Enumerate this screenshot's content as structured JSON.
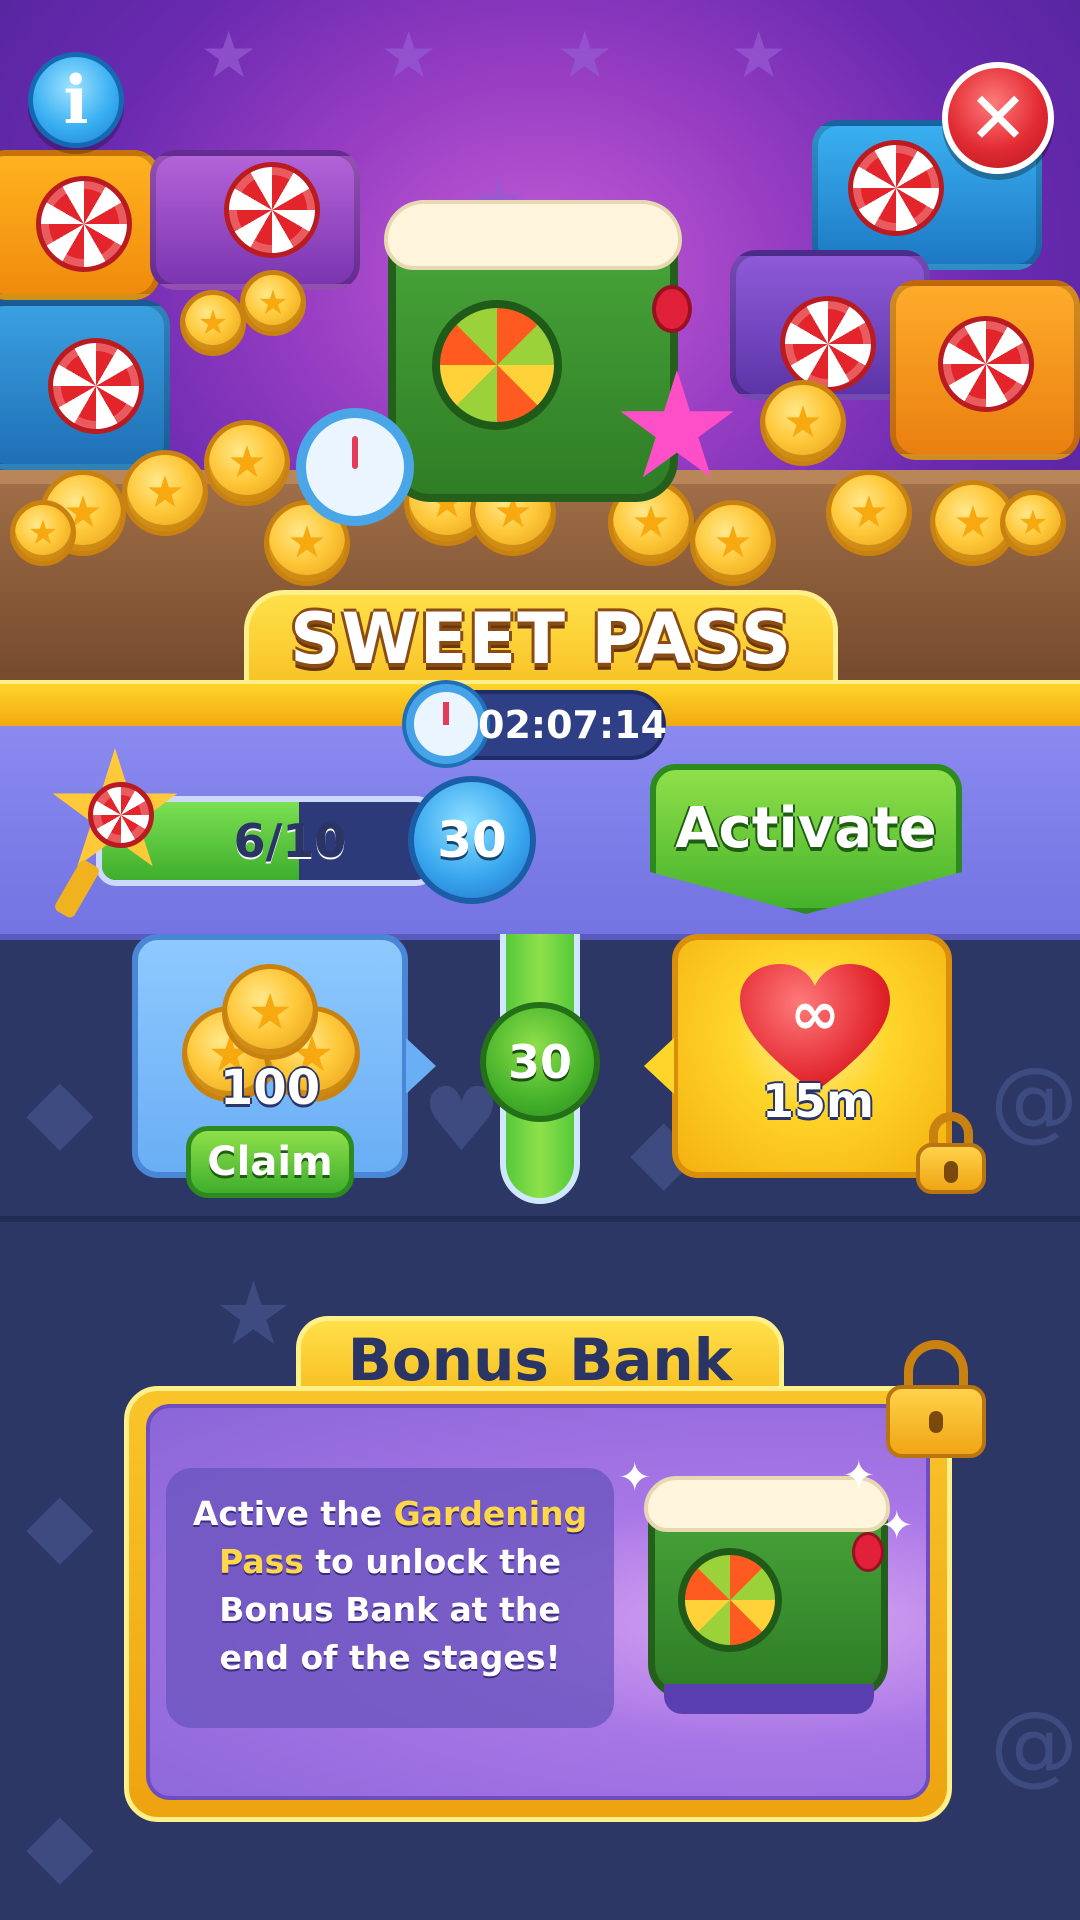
{
  "header": {
    "title": "SWEET PASS",
    "timer": "02:07:14"
  },
  "progress": {
    "current": 6,
    "total": 10,
    "label": "6/10",
    "level": "30",
    "activate_label": "Activate"
  },
  "rewards": {
    "free": {
      "amount": "100",
      "claim_label": "Claim"
    },
    "track_level": "30",
    "premium": {
      "amount": "15m",
      "symbol": "∞"
    }
  },
  "bonus_bank": {
    "title": "Bonus Bank",
    "message_before": "Active the ",
    "message_highlight": "Gardening Pass",
    "message_after": " to unlock the Bonus Bank at the end of the stages!"
  },
  "icons": {
    "info": "i",
    "close": "✕",
    "star": "★",
    "sparkle": "✦"
  },
  "colors": {
    "accent_yellow": "#ffd52a",
    "band_purple": "#7f7fe8",
    "activate_green": "#45b22b",
    "background_navy": "#2c3766",
    "highlight_text": "#ffd84a"
  }
}
